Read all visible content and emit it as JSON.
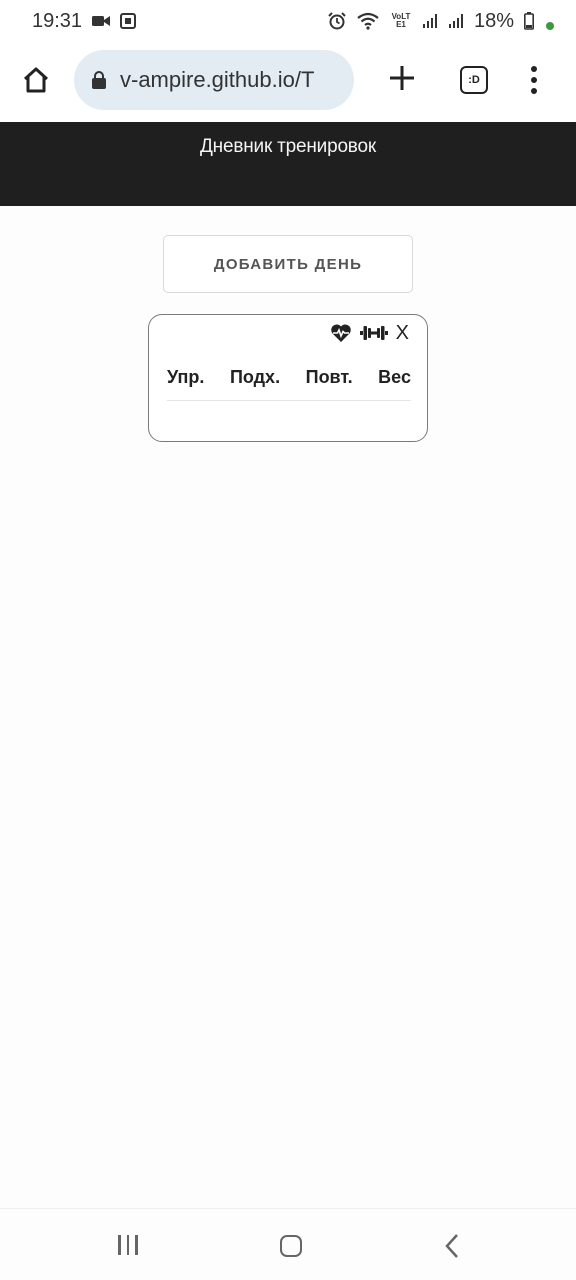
{
  "status_bar": {
    "time": "19:31",
    "battery": "18%",
    "network_label": "VoLTE1"
  },
  "browser": {
    "url": "v-ampire.github.io/T",
    "tabs_label": ":D"
  },
  "app": {
    "title": "Дневник тренировок",
    "add_day_label": "ДОБАВИТЬ ДЕНЬ"
  },
  "day_card": {
    "columns": [
      "Упр.",
      "Подх.",
      "Повт.",
      "Вес"
    ],
    "close_label": "X"
  },
  "icons": {
    "home": "home-icon",
    "lock": "lock-icon",
    "new_tab": "plus-icon",
    "menu": "more-vert-icon",
    "heart": "heart-pulse-icon",
    "dumbbell": "dumbbell-icon"
  }
}
